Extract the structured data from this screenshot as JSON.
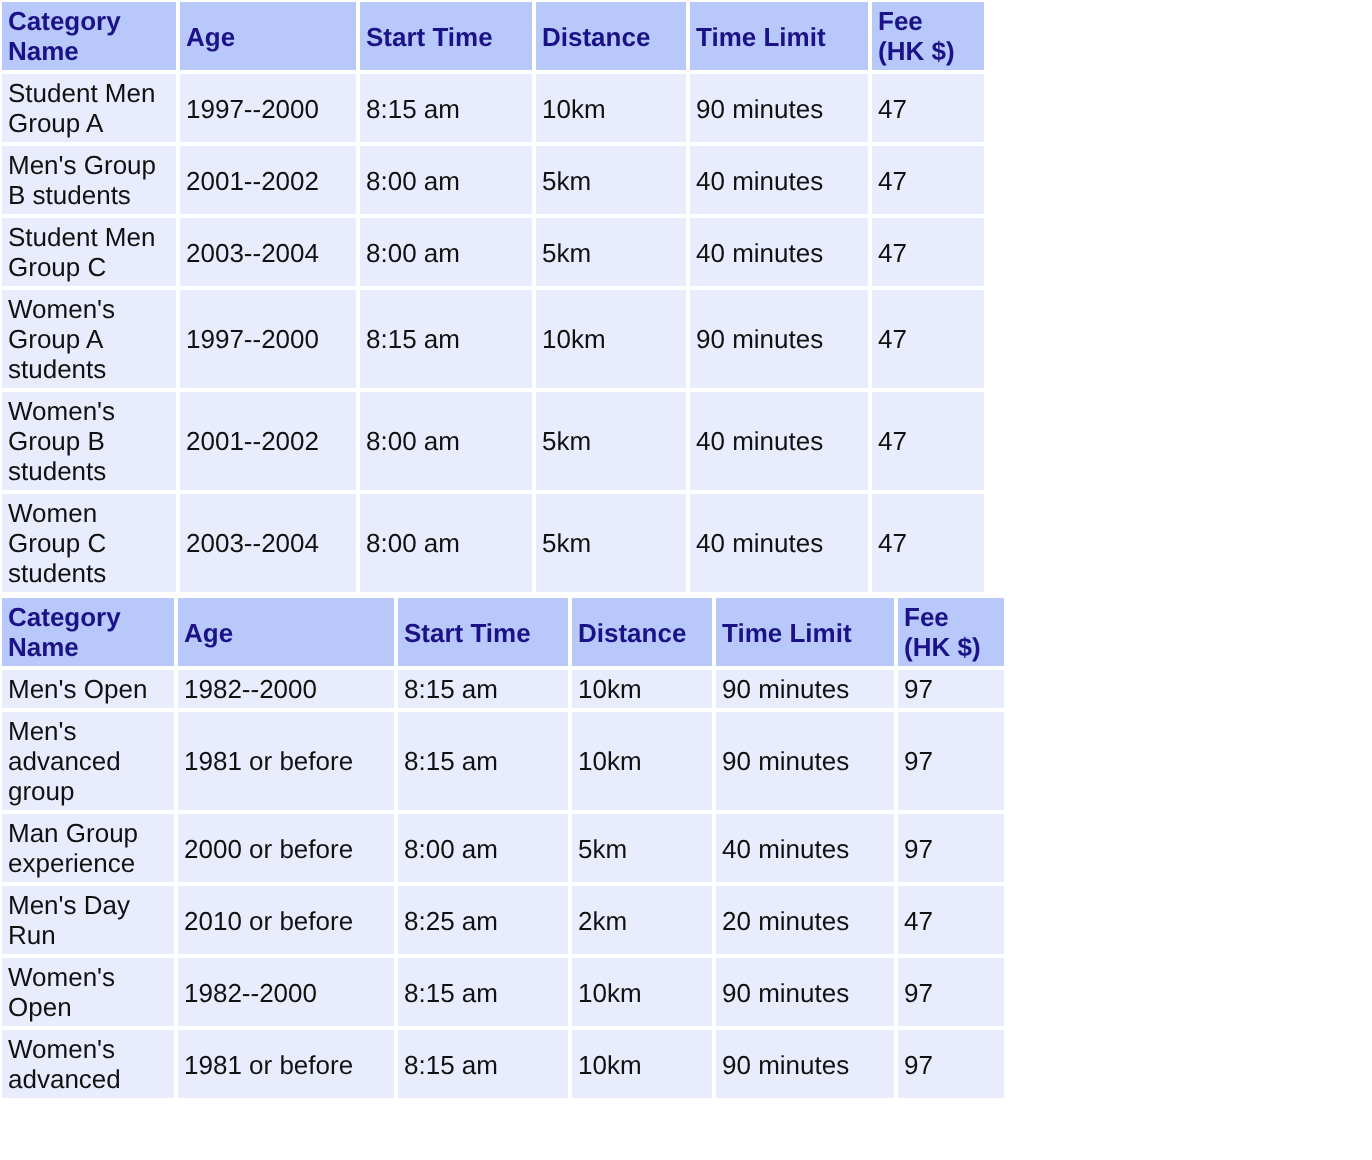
{
  "tables": [
    {
      "columns": [
        "Category Name",
        "Age",
        "Start Time",
        "Distance",
        "Time Limit",
        "Fee (HK $)"
      ],
      "rows": [
        [
          "Student Men Group A",
          "1997--2000",
          "8:15 am",
          "10km",
          "90 minutes",
          "47"
        ],
        [
          "Men's Group B students",
          "2001--2002",
          "8:00 am",
          "5km",
          "40 minutes",
          "47"
        ],
        [
          "Student Men Group C",
          "2003--2004",
          "8:00 am",
          "5km",
          "40 minutes",
          "47"
        ],
        [
          "Women's Group A students",
          "1997--2000",
          "8:15 am",
          "10km",
          "90 minutes",
          "47"
        ],
        [
          "Women's Group B students",
          "2001--2002",
          "8:00 am",
          "5km",
          "40 minutes",
          "47"
        ],
        [
          "Women Group C students",
          "2003--2004",
          "8:00 am",
          "5km",
          "40 minutes",
          "47"
        ]
      ]
    },
    {
      "columns": [
        "Category Name",
        "Age",
        "Start Time",
        "Distance",
        "Time Limit",
        "Fee (HK $)"
      ],
      "rows": [
        [
          "Men's Open",
          "1982--2000",
          "8:15 am",
          "10km",
          "90 minutes",
          "97"
        ],
        [
          "Men's advanced group",
          "1981 or before",
          "8:15 am",
          "10km",
          "90 minutes",
          "97"
        ],
        [
          "Man Group experience",
          "2000 or before",
          "8:00 am",
          "5km",
          "40 minutes",
          "97"
        ],
        [
          "Men's Day Run",
          "2010 or before",
          "8:25 am",
          "2km",
          "20 minutes",
          "47"
        ],
        [
          "Women's Open",
          "1982--2000",
          "8:15 am",
          "10km",
          "90 minutes",
          "97"
        ],
        [
          "Women's advanced",
          "1981 or before",
          "8:15 am",
          "10km",
          "90 minutes",
          "97"
        ]
      ]
    }
  ]
}
